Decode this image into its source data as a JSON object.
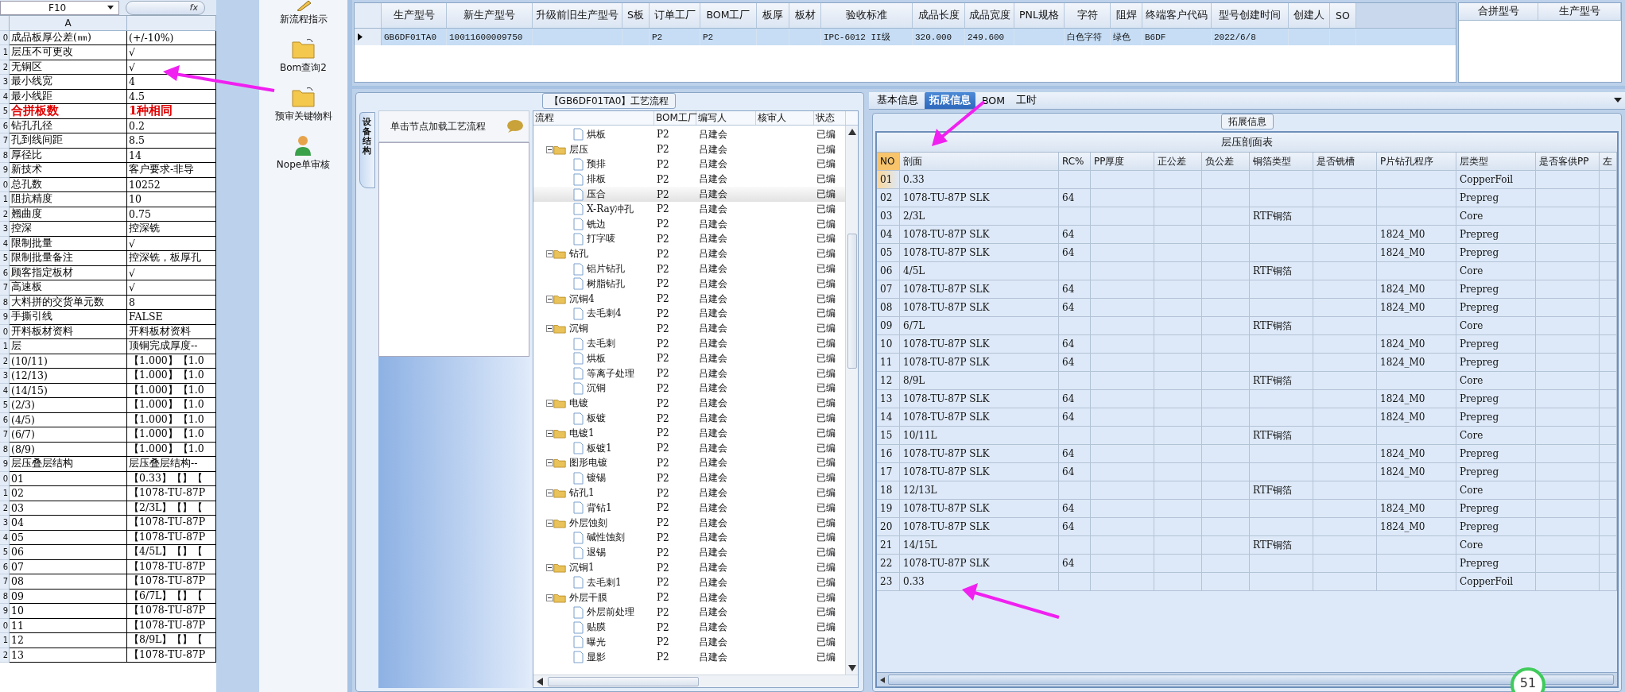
{
  "spreadsheet": {
    "name_box": "F10",
    "formula_icon": "fx",
    "column_header": "A",
    "rows": [
      {
        "num": "0",
        "a": "成品板厚公差(㎜)",
        "b": "(+/-10%)",
        "emphasis": false
      },
      {
        "num": "1",
        "a": "层压不可更改",
        "b": "√",
        "emphasis": false
      },
      {
        "num": "2",
        "a": "无铜区",
        "b": "√",
        "emphasis": false
      },
      {
        "num": "3",
        "a": "最小线宽",
        "b": "4",
        "emphasis": false
      },
      {
        "num": "4",
        "a": "最小线距",
        "b": "4.5",
        "emphasis": false
      },
      {
        "num": "5",
        "a": "合拼板数",
        "b": "1种相同",
        "emphasis": true
      },
      {
        "num": "6",
        "a": "钻孔孔径",
        "b": "0.2",
        "emphasis": false
      },
      {
        "num": "7",
        "a": "孔到线间距",
        "b": "8.5",
        "emphasis": false
      },
      {
        "num": "8",
        "a": "厚径比",
        "b": "14",
        "emphasis": false
      },
      {
        "num": "9",
        "a": "新技术",
        "b": "客户要求-非导",
        "emphasis": false
      },
      {
        "num": "0",
        "a": "总孔数",
        "b": "10252",
        "emphasis": false
      },
      {
        "num": "1",
        "a": "阻抗精度",
        "b": "10",
        "emphasis": false
      },
      {
        "num": "2",
        "a": "翘曲度",
        "b": "0.75",
        "emphasis": false
      },
      {
        "num": "3",
        "a": "控深",
        "b": "控深铣",
        "emphasis": false
      },
      {
        "num": "4",
        "a": "限制批量",
        "b": "√",
        "emphasis": false
      },
      {
        "num": "5",
        "a": "限制批量备注",
        "b": "控深铣，板厚孔",
        "emphasis": false
      },
      {
        "num": "6",
        "a": "顾客指定板材",
        "b": "√",
        "emphasis": false
      },
      {
        "num": "7",
        "a": "高速板",
        "b": "√",
        "emphasis": false
      },
      {
        "num": "8",
        "a": "大料拼的交货单元数",
        "b": "8",
        "emphasis": false
      },
      {
        "num": "9",
        "a": "手撕引线",
        "b": "FALSE",
        "emphasis": false
      },
      {
        "num": "0",
        "a": "开料板材资料",
        "b": "开料板材资料",
        "emphasis": false
      },
      {
        "num": "1",
        "a": "层",
        "b": "顶铜完成厚度--",
        "emphasis": false
      },
      {
        "num": "2",
        "a": "(10/11)",
        "b": "【1.000】【1.0",
        "emphasis": false
      },
      {
        "num": "3",
        "a": "(12/13)",
        "b": "【1.000】【1.0",
        "emphasis": false
      },
      {
        "num": "4",
        "a": "(14/15)",
        "b": "【1.000】【1.0",
        "emphasis": false
      },
      {
        "num": "5",
        "a": "(2/3)",
        "b": "【1.000】【1.0",
        "emphasis": false
      },
      {
        "num": "6",
        "a": "(4/5)",
        "b": "【1.000】【1.0",
        "emphasis": false
      },
      {
        "num": "7",
        "a": "(6/7)",
        "b": "【1.000】【1.0",
        "emphasis": false
      },
      {
        "num": "8",
        "a": "(8/9)",
        "b": "【1.000】【1.0",
        "emphasis": false
      },
      {
        "num": "9",
        "a": "层压叠层结构",
        "b": "层压叠层结构--",
        "emphasis": false
      },
      {
        "num": "0",
        "a": "01",
        "b": "【0.33】【】【",
        "emphasis": false
      },
      {
        "num": "1",
        "a": "02",
        "b": "【1078-TU-87P",
        "emphasis": false
      },
      {
        "num": "2",
        "a": "03",
        "b": "【2/3L】【】【",
        "emphasis": false
      },
      {
        "num": "3",
        "a": "04",
        "b": "【1078-TU-87P",
        "emphasis": false
      },
      {
        "num": "4",
        "a": "05",
        "b": "【1078-TU-87P",
        "emphasis": false
      },
      {
        "num": "5",
        "a": "06",
        "b": "【4/5L】【】【",
        "emphasis": false
      },
      {
        "num": "6",
        "a": "07",
        "b": "【1078-TU-87P",
        "emphasis": false
      },
      {
        "num": "7",
        "a": "08",
        "b": "【1078-TU-87P",
        "emphasis": false
      },
      {
        "num": "8",
        "a": "09",
        "b": "【6/7L】【】【",
        "emphasis": false
      },
      {
        "num": "9",
        "a": "10",
        "b": "【1078-TU-87P",
        "emphasis": false
      },
      {
        "num": "0",
        "a": "11",
        "b": "【1078-TU-87P",
        "emphasis": false
      },
      {
        "num": "1",
        "a": "12",
        "b": "【8/9L】【】【",
        "emphasis": false
      },
      {
        "num": "2",
        "a": "13",
        "b": "【1078-TU-87P",
        "emphasis": false
      }
    ]
  },
  "launcher": [
    {
      "label": "新流程指示",
      "kind": "pencil"
    },
    {
      "label": "Bom查询2",
      "kind": "folder"
    },
    {
      "label": "预审关键物料",
      "kind": "folder"
    },
    {
      "label": "Nope单审核",
      "kind": "user"
    }
  ],
  "model_grid": {
    "row_selected": true,
    "columns": [
      {
        "label": "生产型号",
        "value": "GB6DF01TA0"
      },
      {
        "label": "新生产型号",
        "value": "10011600009750"
      },
      {
        "label": "升级前旧生产型号"
      },
      {
        "label": "S板"
      },
      {
        "label": "订单工厂",
        "value": "P2"
      },
      {
        "label": "BOM工厂",
        "value": "P2"
      },
      {
        "label": "板厚"
      },
      {
        "label": "板材"
      },
      {
        "label": "验收标准",
        "value": "IPC-6012 II级"
      },
      {
        "label": "成品长度",
        "value": "320.000"
      },
      {
        "label": "成品宽度",
        "value": "249.600"
      },
      {
        "label": "PNL规格"
      },
      {
        "label": "字符",
        "value": "白色字符"
      },
      {
        "label": "阻焊",
        "value": "绿色"
      },
      {
        "label": "终端客户代码",
        "value": "B6DF"
      },
      {
        "label": "型号创建时间",
        "value": "2022/6/8"
      },
      {
        "label": "创建人"
      },
      {
        "label": "SO"
      }
    ]
  },
  "merge_grid": {
    "columns": [
      "合拼型号",
      "生产型号"
    ]
  },
  "process": {
    "title": "【GB6DF01TA0】工艺流程",
    "side_tab": "设备结构",
    "hint": "单击节点加载工艺流程",
    "columns": [
      "流程",
      "BOM工厂",
      "编写人",
      "核审人",
      "状态"
    ],
    "tree": [
      {
        "kind": "group",
        "children": [
          {
            "kind": "step",
            "name": "烘板",
            "factory": "P2",
            "writer": "吕建会",
            "status": "已编",
            "selected": false
          }
        ]
      },
      {
        "kind": "folder",
        "name": "层压",
        "factory": "P2",
        "writer": "吕建会",
        "status": "已编",
        "selected": false,
        "children": [
          {
            "kind": "step",
            "name": "预排",
            "factory": "P2",
            "writer": "吕建会",
            "status": "已编",
            "selected": false
          },
          {
            "kind": "step",
            "name": "排板",
            "factory": "P2",
            "writer": "吕建会",
            "status": "已编",
            "selected": false
          },
          {
            "kind": "step",
            "name": "压合",
            "factory": "P2",
            "writer": "吕建会",
            "status": "已编",
            "selected": true
          },
          {
            "kind": "step",
            "name": "X-Ray冲孔",
            "factory": "P2",
            "writer": "吕建会",
            "status": "已编",
            "selected": false
          },
          {
            "kind": "step",
            "name": "铣边",
            "factory": "P2",
            "writer": "吕建会",
            "status": "已编",
            "selected": false
          },
          {
            "kind": "step",
            "name": "打字唛",
            "factory": "P2",
            "writer": "吕建会",
            "status": "已编",
            "selected": false
          }
        ]
      },
      {
        "kind": "folder",
        "name": "钻孔",
        "factory": "P2",
        "writer": "吕建会",
        "status": "已编",
        "selected": false,
        "children": [
          {
            "kind": "step",
            "name": "铝片钻孔",
            "factory": "P2",
            "writer": "吕建会",
            "status": "已编",
            "selected": false
          },
          {
            "kind": "step",
            "name": "树脂钻孔",
            "factory": "P2",
            "writer": "吕建会",
            "status": "已编",
            "selected": false
          }
        ]
      },
      {
        "kind": "folder",
        "name": "沉铜4",
        "factory": "P2",
        "writer": "吕建会",
        "status": "已编",
        "selected": false,
        "children": [
          {
            "kind": "step",
            "name": "去毛刺4",
            "factory": "P2",
            "writer": "吕建会",
            "status": "已编",
            "selected": false
          }
        ]
      },
      {
        "kind": "folder",
        "name": "沉铜",
        "factory": "P2",
        "writer": "吕建会",
        "status": "已编",
        "selected": false,
        "children": [
          {
            "kind": "step",
            "name": "去毛刺",
            "factory": "P2",
            "writer": "吕建会",
            "status": "已编",
            "selected": false
          },
          {
            "kind": "step",
            "name": "烘板",
            "factory": "P2",
            "writer": "吕建会",
            "status": "已编",
            "selected": false
          },
          {
            "kind": "step",
            "name": "等离子处理",
            "factory": "P2",
            "writer": "吕建会",
            "status": "已编",
            "selected": false
          },
          {
            "kind": "step",
            "name": "沉铜",
            "factory": "P2",
            "writer": "吕建会",
            "status": "已编",
            "selected": false
          }
        ]
      },
      {
        "kind": "folder",
        "name": "电镀",
        "factory": "P2",
        "writer": "吕建会",
        "status": "已编",
        "selected": false,
        "children": [
          {
            "kind": "step",
            "name": "板镀",
            "factory": "P2",
            "writer": "吕建会",
            "status": "已编",
            "selected": false
          }
        ]
      },
      {
        "kind": "folder",
        "name": "电镀1",
        "factory": "P2",
        "writer": "吕建会",
        "status": "已编",
        "selected": false,
        "children": [
          {
            "kind": "step",
            "name": "板镀1",
            "factory": "P2",
            "writer": "吕建会",
            "status": "已编",
            "selected": false
          }
        ]
      },
      {
        "kind": "folder",
        "name": "图形电镀",
        "factory": "P2",
        "writer": "吕建会",
        "status": "已编",
        "selected": false,
        "children": [
          {
            "kind": "step",
            "name": "镀锡",
            "factory": "P2",
            "writer": "吕建会",
            "status": "已编",
            "selected": false
          }
        ]
      },
      {
        "kind": "folder",
        "name": "钻孔1",
        "factory": "P2",
        "writer": "吕建会",
        "status": "已编",
        "selected": false,
        "children": [
          {
            "kind": "step",
            "name": "背钻1",
            "factory": "P2",
            "writer": "吕建会",
            "status": "已编",
            "selected": false
          }
        ]
      },
      {
        "kind": "folder",
        "name": "外层蚀刻",
        "factory": "P2",
        "writer": "吕建会",
        "status": "已编",
        "selected": false,
        "children": [
          {
            "kind": "step",
            "name": "碱性蚀刻",
            "factory": "P2",
            "writer": "吕建会",
            "status": "已编",
            "selected": false
          },
          {
            "kind": "step",
            "name": "退锡",
            "factory": "P2",
            "writer": "吕建会",
            "status": "已编",
            "selected": false
          }
        ]
      },
      {
        "kind": "folder",
        "name": "沉铜1",
        "factory": "P2",
        "writer": "吕建会",
        "status": "已编",
        "selected": false,
        "children": [
          {
            "kind": "step",
            "name": "去毛刺1",
            "factory": "P2",
            "writer": "吕建会",
            "status": "已编",
            "selected": false
          }
        ]
      },
      {
        "kind": "folder",
        "name": "外层干膜",
        "factory": "P2",
        "writer": "吕建会",
        "status": "已编",
        "selected": false,
        "children": [
          {
            "kind": "step",
            "name": "外层前处理",
            "factory": "P2",
            "writer": "吕建会",
            "status": "已编",
            "selected": false
          },
          {
            "kind": "step",
            "name": "贴膜",
            "factory": "P2",
            "writer": "吕建会",
            "status": "已编",
            "selected": false
          },
          {
            "kind": "step",
            "name": "曝光",
            "factory": "P2",
            "writer": "吕建会",
            "status": "已编",
            "selected": false
          },
          {
            "kind": "step",
            "name": "显影",
            "factory": "P2",
            "writer": "吕建会",
            "status": "已编",
            "selected": false
          }
        ]
      }
    ]
  },
  "detail": {
    "tabs": [
      {
        "label": "基本信息",
        "selected": false
      },
      {
        "label": "拓展信息",
        "selected": true
      },
      {
        "label": "BOM",
        "selected": false
      },
      {
        "label": "工时",
        "selected": false
      }
    ],
    "group_title": "拓展信息",
    "table": {
      "caption": "层压剖面表",
      "columns": [
        "NO",
        "剖面",
        "RC%",
        "PP厚度",
        "正公差",
        "负公差",
        "铜箔类型",
        "是否铣槽",
        "P片钻孔程序",
        "层类型",
        "是否客供PP",
        "左"
      ],
      "rows": [
        {
          "no": "01",
          "section": "0.33",
          "layer_type": "CopperFoil",
          "selected": true
        },
        {
          "no": "02",
          "section": "1078-TU-87P SLK",
          "rc": "64",
          "layer_type": "Prepreg",
          "selected": false
        },
        {
          "no": "03",
          "section": "2/3L",
          "foil": "RTF铜箔",
          "layer_type": "Core",
          "selected": false
        },
        {
          "no": "04",
          "section": "1078-TU-87P SLK",
          "rc": "64",
          "drill": "1824_M0",
          "layer_type": "Prepreg",
          "selected": false
        },
        {
          "no": "05",
          "section": "1078-TU-87P SLK",
          "rc": "64",
          "drill": "1824_M0",
          "layer_type": "Prepreg",
          "selected": false
        },
        {
          "no": "06",
          "section": "4/5L",
          "foil": "RTF铜箔",
          "layer_type": "Core",
          "selected": false
        },
        {
          "no": "07",
          "section": "1078-TU-87P SLK",
          "rc": "64",
          "drill": "1824_M0",
          "layer_type": "Prepreg",
          "selected": false
        },
        {
          "no": "08",
          "section": "1078-TU-87P SLK",
          "rc": "64",
          "drill": "1824_M0",
          "layer_type": "Prepreg",
          "selected": false
        },
        {
          "no": "09",
          "section": "6/7L",
          "foil": "RTF铜箔",
          "layer_type": "Core",
          "selected": false
        },
        {
          "no": "10",
          "section": "1078-TU-87P SLK",
          "rc": "64",
          "drill": "1824_M0",
          "layer_type": "Prepreg",
          "selected": false
        },
        {
          "no": "11",
          "section": "1078-TU-87P SLK",
          "rc": "64",
          "drill": "1824_M0",
          "layer_type": "Prepreg",
          "selected": false
        },
        {
          "no": "12",
          "section": "8/9L",
          "foil": "RTF铜箔",
          "layer_type": "Core",
          "selected": false
        },
        {
          "no": "13",
          "section": "1078-TU-87P SLK",
          "rc": "64",
          "drill": "1824_M0",
          "layer_type": "Prepreg",
          "selected": false
        },
        {
          "no": "14",
          "section": "1078-TU-87P SLK",
          "rc": "64",
          "drill": "1824_M0",
          "layer_type": "Prepreg",
          "selected": false
        },
        {
          "no": "15",
          "section": "10/11L",
          "foil": "RTF铜箔",
          "layer_type": "Core",
          "selected": false
        },
        {
          "no": "16",
          "section": "1078-TU-87P SLK",
          "rc": "64",
          "drill": "1824_M0",
          "layer_type": "Prepreg",
          "selected": false
        },
        {
          "no": "17",
          "section": "1078-TU-87P SLK",
          "rc": "64",
          "drill": "1824_M0",
          "layer_type": "Prepreg",
          "selected": false
        },
        {
          "no": "18",
          "section": "12/13L",
          "foil": "RTF铜箔",
          "layer_type": "Core",
          "selected": false
        },
        {
          "no": "19",
          "section": "1078-TU-87P SLK",
          "rc": "64",
          "drill": "1824_M0",
          "layer_type": "Prepreg",
          "selected": false
        },
        {
          "no": "20",
          "section": "1078-TU-87P SLK",
          "rc": "64",
          "drill": "1824_M0",
          "layer_type": "Prepreg",
          "selected": false
        },
        {
          "no": "21",
          "section": "14/15L",
          "foil": "RTF铜箔",
          "layer_type": "Core",
          "selected": false
        },
        {
          "no": "22",
          "section": "1078-TU-87P SLK",
          "rc": "64",
          "layer_type": "Prepreg",
          "selected": false
        },
        {
          "no": "23",
          "section": "0.33",
          "layer_type": "CopperFoil",
          "selected": false
        }
      ]
    }
  },
  "badge": "51"
}
